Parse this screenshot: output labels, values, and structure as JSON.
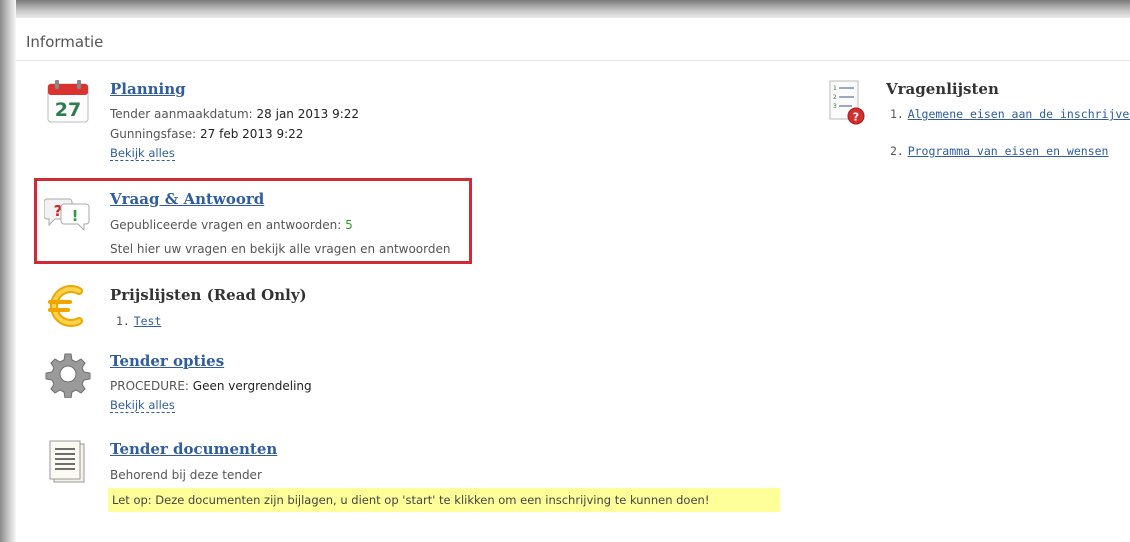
{
  "panel": {
    "title": "Informatie"
  },
  "planning": {
    "icon": "calendar-icon",
    "icon_day": "27",
    "title": "Planning",
    "created_label": "Tender aanmaakdatum:",
    "created_value": "28 jan 2013 9:22",
    "award_label": "Gunningsfase:",
    "award_value": "27 feb 2013 9:22",
    "view_all": "Bekijk alles"
  },
  "qa": {
    "icon": "question-answer-icon",
    "title": "Vraag & Antwoord",
    "published_label": "Gepubliceerde vragen en antwoorden:",
    "published_count": "5",
    "description": "Stel hier uw vragen en bekijk alle vragen en antwoorden"
  },
  "pricelists": {
    "icon": "euro-icon",
    "title": "Prijslijsten (Read Only)",
    "items": [
      {
        "num": "1.",
        "label": "Test"
      }
    ]
  },
  "options": {
    "icon": "gear-icon",
    "title": "Tender opties",
    "procedure_label": "PROCEDURE:",
    "procedure_value": "Geen vergrendeling",
    "view_all": "Bekijk alles"
  },
  "documents": {
    "icon": "document-icon",
    "title": "Tender documenten",
    "description": "Behorend bij deze tender",
    "notice": "Let op: Deze documenten zijn bijlagen, u dient op 'start' te klikken om een inschrijving te kunnen doen!"
  },
  "questionnaires": {
    "icon": "checklist-question-icon",
    "title": "Vragenlijsten",
    "items": [
      {
        "num": "1.",
        "label": "Algemene eisen aan de inschrijver"
      },
      {
        "num": "2.",
        "label": "Programma van eisen en wensen"
      }
    ]
  },
  "colors": {
    "link": "#2f5da0",
    "highlight_border": "#d02a35",
    "notice_bg": "#ffff99",
    "count_green": "#2a9a2a"
  }
}
